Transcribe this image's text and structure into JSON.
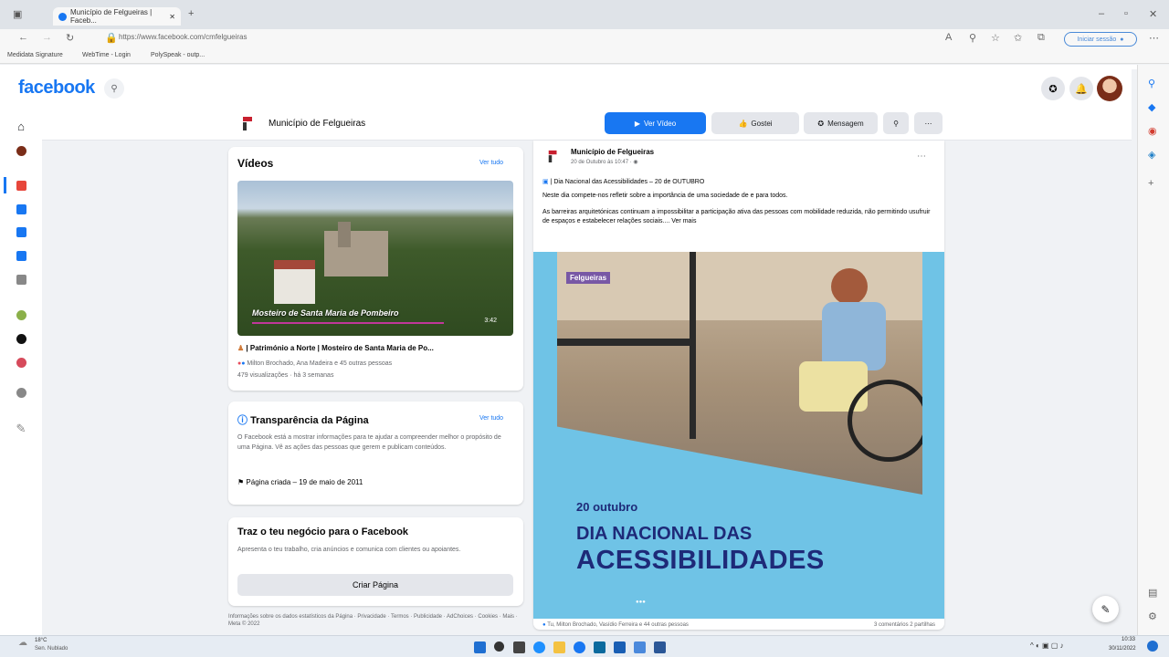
{
  "browser": {
    "tab_title": "Município de Felgueiras | Faceb...",
    "url": "https://www.facebook.com/cmfelgueiras",
    "favorites": [
      "Medidata Signature",
      "WebTime - Login",
      "PolySpeak - outp..."
    ],
    "signin_label": "Iniciar sessão"
  },
  "facebook": {
    "logo": "facebook"
  },
  "page": {
    "name": "Município de Felgueiras",
    "btn_video": "Ver Vídeo",
    "btn_like": "Gostei",
    "btn_message": "Mensagem"
  },
  "videos_card": {
    "title": "Vídeos",
    "see_all": "Ver tudo",
    "thumb_caption": "Mosteiro de Santa Maria de Pombeiro",
    "duration": "3:42",
    "video_title": "| Património a Norte | Mosteiro de Santa Maria de Po...",
    "reactions": "Milton Brochado, Ana Madeira e 45 outras pessoas",
    "views": "479 visualizações · há 3 semanas"
  },
  "transparency_card": {
    "title": "Transparência da Página",
    "see_all": "Ver tudo",
    "body": "O Facebook está a mostrar informações para te ajudar a compreender melhor o propósito de uma Página. Vê as ações das pessoas que gerem e publicam conteúdos.",
    "created": "Página criada – 19 de maio de 2011"
  },
  "business_card": {
    "title": "Traz o teu negócio para o Facebook",
    "body": "Apresenta o teu trabalho, cria anúncios e comunica com clientes ou apoiantes.",
    "button": "Criar Página"
  },
  "footer_links": "Informações sobre os dados estatísticos da Página · Privacidade · Termos · Publicidade · AdChoices · Cookies · Mais · Meta © 2022",
  "post": {
    "author": "Município de Felgueiras",
    "time": "20 de Outubro às 10:47 · ",
    "line1": "| Dia Nacional das Acessibilidades – 20 de OUTUBRO",
    "line2": "Neste dia compete-nos refletir sobre a importância de uma sociedade de e para todos.",
    "line3": "As barreiras arquitetónicas continuam a impossibilitar a participação ativa das pessoas com mobilidade reduzida, não permitindo usufruir de espaços e estabelecer relações sociais.... Ver mais",
    "img_brand": "Felgueiras",
    "img_date": "20 outubro",
    "img_line1": "DIA NACIONAL DAS",
    "img_line2": "ACESSIBILIDADES",
    "reactions": "Tu, Milton Brochado, Vasídio Ferreira e 44 outras pessoas",
    "stats": "3 comentários  2 partilhas"
  },
  "taskbar": {
    "weather_temp": "18°C",
    "weather_desc": "Sen. Nublado",
    "clock_time": "10:33",
    "clock_date": "30/11/2022"
  },
  "colors": {
    "fb_blue": "#1877f2",
    "taskbar": "#e6ecf3",
    "poster_bg": "#6fc3e6",
    "poster_text": "#1e2a78"
  }
}
